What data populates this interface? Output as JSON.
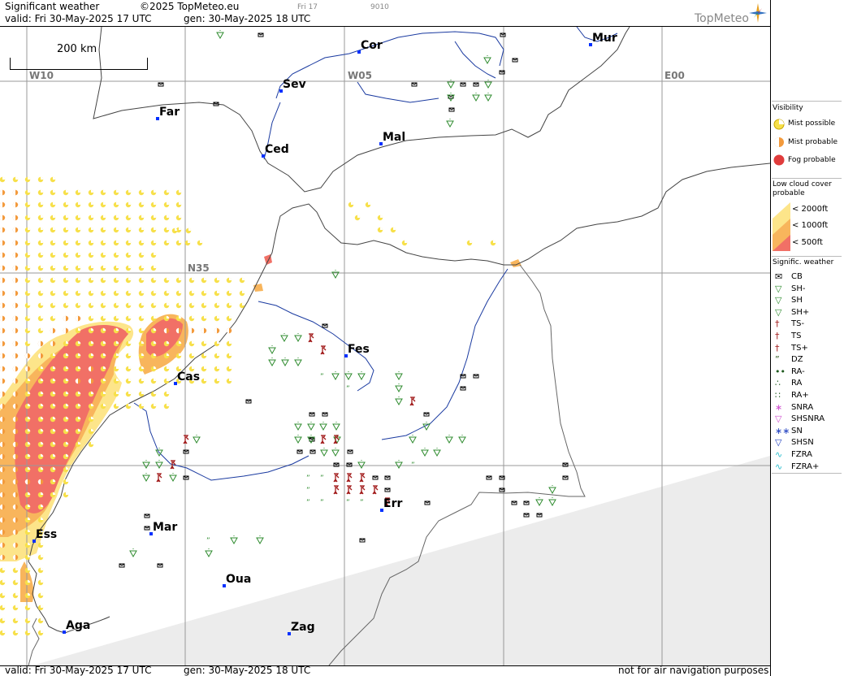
{
  "header": {
    "title": "Significant weather",
    "copyright": "©2025 TopMeteo.eu",
    "fri_label": "Fri 17",
    "code_label": "9010",
    "valid": "valid:  Fri  30-May-2025  17 UTC",
    "gen": "gen: 30-May-2025 18 UTC",
    "logo": "TopMeteo"
  },
  "footer": {
    "valid": "valid:  Fri  30-May-2025  17 UTC",
    "gen": "gen: 30-May-2025 18 UTC",
    "disclaimer": "not for air navigation purposes"
  },
  "scale": {
    "label": "200 km"
  },
  "grid_labels": {
    "w10": "W10",
    "w05": "W05",
    "e00": "E00",
    "n35": "N35"
  },
  "cities": [
    {
      "name": "Cor"
    },
    {
      "name": "Mur"
    },
    {
      "name": "Sev"
    },
    {
      "name": "Far"
    },
    {
      "name": "Ced"
    },
    {
      "name": "Mal"
    },
    {
      "name": "Fes"
    },
    {
      "name": "Cas"
    },
    {
      "name": "Mar"
    },
    {
      "name": "Err"
    },
    {
      "name": "Ess"
    },
    {
      "name": "Oua"
    },
    {
      "name": "Zag"
    },
    {
      "name": "Aga"
    }
  ],
  "legend": {
    "visibility_title": "Visibility",
    "mist_possible": "Mist possible",
    "mist_probable": "Mist probable",
    "fog_probable": "Fog probable",
    "low_cloud_title": "Low cloud cover probable",
    "lc_2000": "< 2000ft",
    "lc_1000": "< 1000ft",
    "lc_500": "<   500ft",
    "sigwx_title": "Signific. weather",
    "sigwx_items": [
      "CB",
      "SH-",
      "SH",
      "SH+",
      "TS-",
      "TS",
      "TS+",
      "DZ",
      "RA-",
      "RA",
      "RA+",
      "SNRA",
      "SHSNRA",
      "SN",
      "SHSN",
      "FZRA",
      "FZRA+"
    ]
  },
  "colors": {
    "mist_possible": "#f7e04a",
    "mist_probable": "#f39a3c",
    "fog_probable": "#e03c3c",
    "lc_2000": "#fde58a",
    "lc_1000": "#f8b55c",
    "lc_500": "#f17066",
    "shower": "#2e8b2e",
    "thunder": "#a01818",
    "outside_domain": "#ececec"
  }
}
